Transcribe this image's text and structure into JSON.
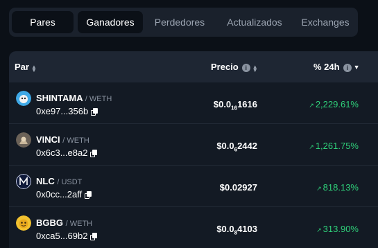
{
  "tabs": [
    {
      "label": "Pares"
    },
    {
      "label": "Ganadores"
    },
    {
      "label": "Perdedores"
    },
    {
      "label": "Actualizados"
    },
    {
      "label": "Exchanges"
    }
  ],
  "active_tab": "Ganadores",
  "columns": {
    "pair": "Par",
    "price": "Precio",
    "change": "% 24h"
  },
  "colors": {
    "positive": "#2fd17a",
    "background": "#0b1017",
    "header": "#1e2633"
  },
  "rows": [
    {
      "symbol": "SHINTAMA",
      "quote": "/ WETH",
      "address": "0xe97...356b",
      "price_prefix": "$0.0",
      "price_zeros": "16",
      "price_digits": "1616",
      "change": "2,229.61%",
      "avatar_icon": "shintama-token-icon"
    },
    {
      "symbol": "VINCI",
      "quote": "/ WETH",
      "address": "0x6c3...e8a2",
      "price_prefix": "$0.0",
      "price_zeros": "6",
      "price_digits": "2442",
      "change": "1,261.75%",
      "avatar_icon": "vinci-token-icon"
    },
    {
      "symbol": "NLC",
      "quote": "/ USDT",
      "address": "0x0cc...2aff",
      "price_prefix": "$0.02927",
      "price_zeros": "",
      "price_digits": "",
      "change": "818.13%",
      "avatar_icon": "nlc-token-icon"
    },
    {
      "symbol": "BGBG",
      "quote": "/ WETH",
      "address": "0xca5...69b2",
      "price_prefix": "$0.0",
      "price_zeros": "8",
      "price_digits": "4103",
      "change": "313.90%",
      "avatar_icon": "bgbg-token-icon"
    }
  ]
}
